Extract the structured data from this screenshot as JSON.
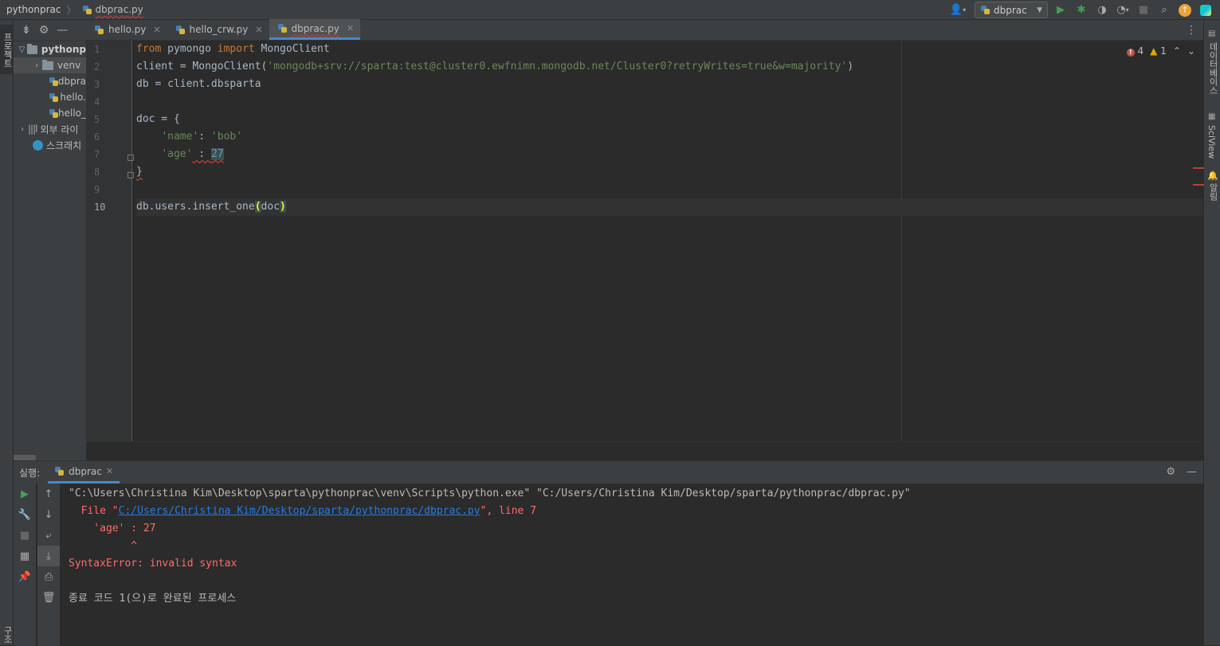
{
  "breadcrumb": {
    "project": "pythonprac",
    "file": "dbprac.py"
  },
  "toolbar": {
    "run_config": "dbprac",
    "icons": [
      "user-icon",
      "python-icon",
      "run-icon",
      "debug-icon",
      "coverage-icon",
      "profile-icon",
      "stop-icon",
      "search-icon",
      "update-icon",
      "jetbrains-icon"
    ]
  },
  "left_strip": {
    "project_tab": "프로젝트",
    "bottom_tab": "구조"
  },
  "project_tree": {
    "items": [
      {
        "label": "pythonp",
        "type": "folder",
        "level": 0
      },
      {
        "label": "venv",
        "type": "folder",
        "level": 1
      },
      {
        "label": "dbpra",
        "type": "python-file",
        "level": 2
      },
      {
        "label": "hello.",
        "type": "python-file",
        "level": 2
      },
      {
        "label": "hello_",
        "type": "python-file",
        "level": 2
      },
      {
        "label": "외부 라이",
        "type": "library",
        "level": 0
      },
      {
        "label": "스크래치",
        "type": "scratch",
        "level": 0
      }
    ]
  },
  "tabs": [
    {
      "label": "hello.py",
      "active": false
    },
    {
      "label": "hello_crw.py",
      "active": false
    },
    {
      "label": "dbprac.py",
      "active": true
    }
  ],
  "inspections": {
    "errors": "4",
    "warnings": "1"
  },
  "line_numbers": [
    "1",
    "2",
    "3",
    "4",
    "5",
    "6",
    "7",
    "8",
    "9",
    "10"
  ],
  "code": {
    "l1_kw1": "from",
    "l1_mod": " pymongo ",
    "l1_kw2": "import",
    "l1_cls": " MongoClient",
    "l2_pre": "client = MongoClient(",
    "l2_str": "'mongodb+srv://sparta:test@cluster0.ewfnimn.mongodb.net/Cluster0?retryWrites=true&w=majority'",
    "l2_post": ")",
    "l3": "db = client.dbsparta",
    "l5": "doc = {",
    "l6_ind": "    ",
    "l6_k": "'name'",
    "l6_sep": ": ",
    "l6_v": "'bob'",
    "l7_ind": "    ",
    "l7_k": "'age'",
    "l7_sep": " : ",
    "l7_v": "27",
    "l8": "}",
    "l10_pre": "db.users.insert_one",
    "l10_open": "(",
    "l10_arg": "doc",
    "l10_close": ")"
  },
  "right_strip": {
    "database": "데이터베이스",
    "sciview": "SciView",
    "notifications": "알림"
  },
  "run_panel": {
    "label": "실행:",
    "tab": "dbprac",
    "console": {
      "cmd": "\"C:\\Users\\Christina Kim\\Desktop\\sparta\\pythonprac\\venv\\Scripts\\python.exe\" \"C:/Users/Christina Kim/Desktop/sparta/pythonprac/dbprac.py\"",
      "file_pre": "  File \"",
      "file_link": "C:/Users/Christina Kim/Desktop/sparta/pythonprac/dbprac.py",
      "file_post": "\", line 7",
      "src": "    'age' : 27",
      "caret": "          ^",
      "error": "SyntaxError: invalid syntax",
      "exit": "종료 코드 1(으)로 완료된 프로세스"
    }
  },
  "colors": {
    "keyword": "#cc7832",
    "string": "#6a8759",
    "number": "#6897bb",
    "error": "#ff6b68",
    "link": "#287bde",
    "run_green": "#499c54"
  }
}
